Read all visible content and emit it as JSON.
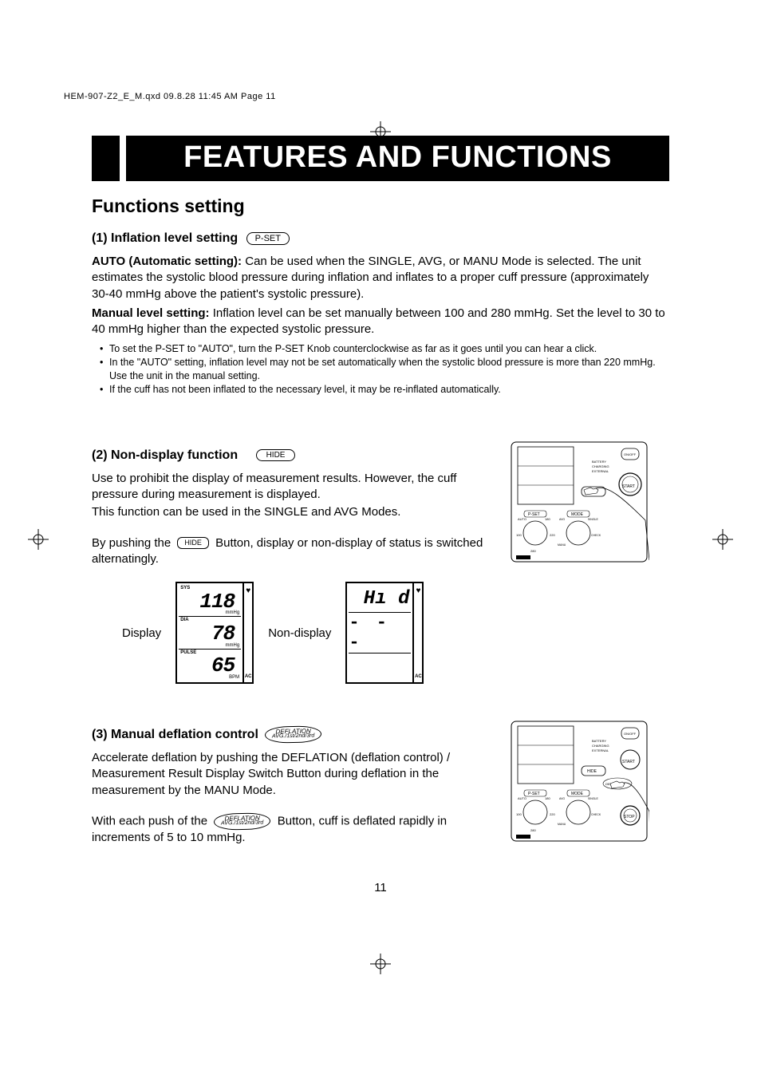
{
  "print_header": "HEM-907-Z2_E_M.qxd  09.8.28  11:45 AM  Page 11",
  "title": "FEATURES AND FUNCTIONS",
  "section_heading": "Functions setting",
  "s1": {
    "heading": "(1) Inflation level setting",
    "pill": "P-SET",
    "auto_label": "AUTO (Automatic setting):",
    "auto_text": " Can be used when the SINGLE, AVG, or MANU Mode is selected. The unit estimates the systolic blood pressure during inflation and inflates to a proper cuff pressure (approximately 30-40 mmHg above the patient's systolic pressure).",
    "manual_label": "Manual level setting:",
    "manual_text": " Inflation level can be set manually between 100 and 280 mmHg. Set the level to 30 to 40 mmHg higher than the expected systolic pressure.",
    "b1": "To set the P-SET to \"AUTO\", turn the P-SET Knob counterclockwise as far as it goes until you can hear a click.",
    "b2": "In the \"AUTO\" setting, inflation level may not be set automatically when the systolic blood pressure is more than 220 mmHg.  Use the unit in the manual setting.",
    "b3": "If the cuff has not been inflated to the necessary level, it may be re-inflated automatically."
  },
  "s2": {
    "heading": "(2) Non-display function",
    "pill": "HIDE",
    "p1": "Use to prohibit the display of measurement results. However, the cuff pressure during measurement is displayed.",
    "p2": "This function can be used in the SINGLE and AVG Modes.",
    "p3a": "By pushing the",
    "btn": "HIDE",
    "p3b": "Button, display or non-display of status is switched alternatingly.",
    "display_label": "Display",
    "nondisplay_label": "Non-display",
    "lcd": {
      "sys_tag": "SYS",
      "sys_val": "118",
      "sys_unit": "mmHg",
      "dia_tag": "DIA",
      "dia_val": "78",
      "dia_unit": "mmHg",
      "pulse_tag": "PULSE",
      "pulse_val": "65",
      "pulse_unit": "BPM",
      "ac": "AC",
      "hid_text": "Hı d",
      "dashes": "- - -"
    }
  },
  "s3": {
    "heading": "(3) Manual deflation control",
    "btn_l1": "DEFLATION",
    "btn_l2": "AVG./1st/2nd/3rd",
    "p1": "Accelerate deflation by pushing the DEFLATION (deflation control) / Measurement Result Display Switch Button during deflation in the measurement by the MANU Mode.",
    "p2a": "With each push of the",
    "p2b": "Button, cuff is deflated rapidly in increments of 5 to 10 mmHg."
  },
  "device": {
    "battery": "BATTERY",
    "charging": "CHARGING",
    "external": "EXTERNAL",
    "pset": "P-SET",
    "mode": "MODE",
    "auto": "AUTO",
    "hide": "HIDE",
    "start": "START",
    "stop": "STOP",
    "onoff": "ON/OFF",
    "n100": "100",
    "n180": "180",
    "n220": "220",
    "n280": "280",
    "single": "SINGLE",
    "avg": "AVG",
    "manu": "MANU",
    "check": "CHECK",
    "deflation": "DEFLATION"
  },
  "page_num": "11"
}
